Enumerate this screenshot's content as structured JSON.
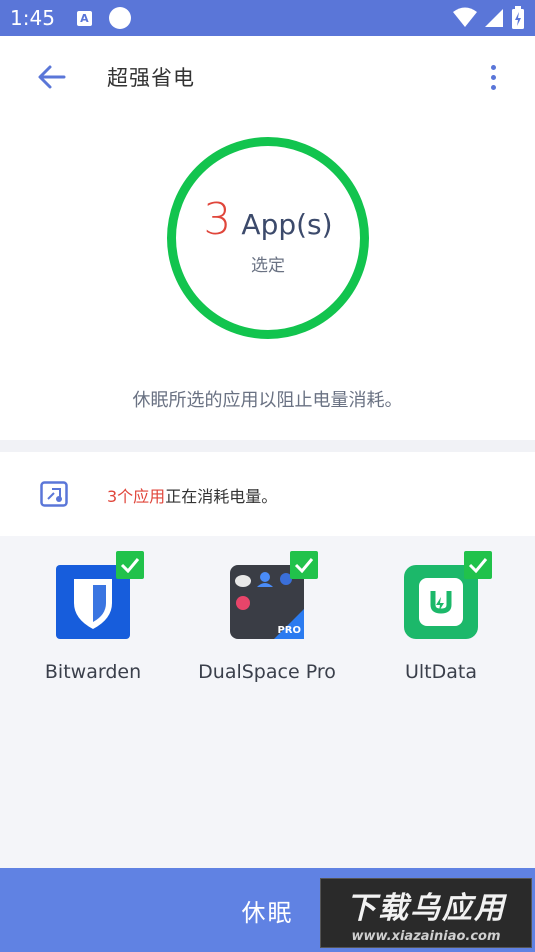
{
  "status_bar": {
    "time": "1:45",
    "a_icon_label": "A"
  },
  "toolbar": {
    "title": "超强省电"
  },
  "summary": {
    "count": "3",
    "unit": "App(s)",
    "sub_label": "选定"
  },
  "description": "休眠所选的应用以阻止电量消耗。",
  "info": {
    "highlight": "3个应用",
    "text": "正在消耗电量。"
  },
  "apps": [
    {
      "name": "Bitwarden",
      "checked": true
    },
    {
      "name": "DualSpace Pro",
      "checked": true
    },
    {
      "name": "UltData",
      "checked": true
    }
  ],
  "dualspace_badge": "PRO",
  "bottom_button": "休眠",
  "watermark": {
    "title": "下载乌应用",
    "url": "www.xiazainiao.com"
  },
  "colors": {
    "accent": "#5a76d8",
    "ring": "#12c44e",
    "highlight": "#e0463b",
    "bottom_bar": "#6082e3"
  }
}
